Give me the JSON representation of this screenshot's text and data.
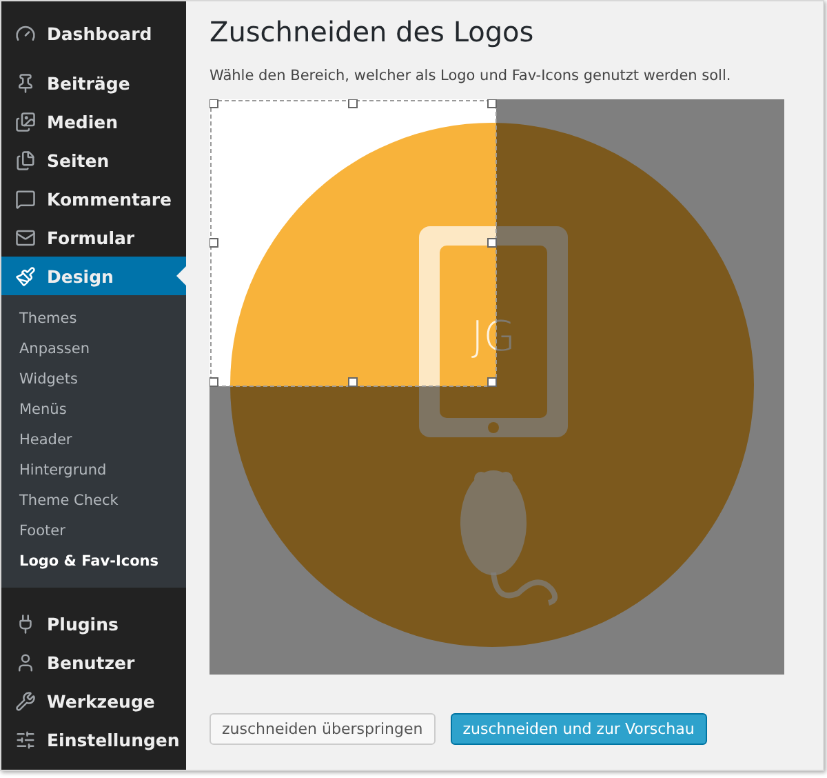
{
  "sidebar": {
    "items": [
      {
        "label": "Dashboard",
        "selected": false
      },
      {
        "label": "Beiträge",
        "selected": false
      },
      {
        "label": "Medien",
        "selected": false
      },
      {
        "label": "Seiten",
        "selected": false
      },
      {
        "label": "Kommentare",
        "selected": false
      },
      {
        "label": "Formular",
        "selected": false
      },
      {
        "label": "Design",
        "selected": true,
        "expanded": true,
        "children": [
          {
            "label": "Themes",
            "selected": false
          },
          {
            "label": "Anpassen",
            "selected": false
          },
          {
            "label": "Widgets",
            "selected": false
          },
          {
            "label": "Menüs",
            "selected": false
          },
          {
            "label": "Header",
            "selected": false
          },
          {
            "label": "Hintergrund",
            "selected": false
          },
          {
            "label": "Theme Check",
            "selected": false
          },
          {
            "label": "Footer",
            "selected": false
          },
          {
            "label": "Logo & Fav-Icons",
            "selected": true
          }
        ]
      },
      {
        "label": "Plugins",
        "selected": false
      },
      {
        "label": "Benutzer",
        "selected": false
      },
      {
        "label": "Werkzeuge",
        "selected": false
      },
      {
        "label": "Einstellungen",
        "selected": false
      }
    ]
  },
  "page": {
    "title": "Zuschneiden des Logos",
    "description": "Wähle den Bereich, welcher als Logo und Fav-Icons genutzt werden soll.",
    "crop": {
      "logo_text": "JG"
    },
    "buttons": [
      {
        "label": "zuschneiden überspringen",
        "kind": "secondary"
      },
      {
        "label": "zuschneiden und zur Vorschau",
        "kind": "primary"
      }
    ]
  }
}
